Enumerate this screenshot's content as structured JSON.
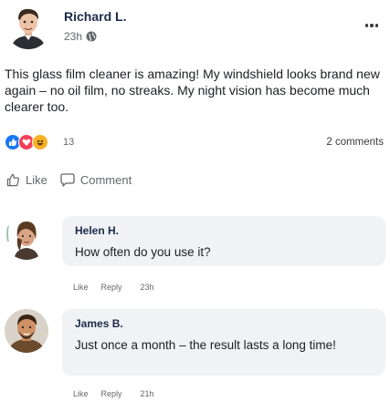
{
  "post": {
    "author": "Richard L.",
    "time": "23h",
    "text": "This glass film cleaner is amazing! My windshield looks brand new again – no oil film, no streaks. My night vision has become much clearer too.",
    "reactions": {
      "icons": [
        "like-reaction",
        "love-reaction",
        "haha-reaction"
      ],
      "colors": {
        "like": "#1877f2",
        "love": "#f33e58",
        "haha": "#f7b125"
      },
      "count": "13"
    },
    "comments_count": "2 comments",
    "actions": {
      "like": "Like",
      "comment": "Comment"
    }
  },
  "comments": [
    {
      "author": "Helen H.",
      "text": "How often do you use it?",
      "actions": {
        "like": "Like",
        "reply": "Reply",
        "time": "23h"
      }
    },
    {
      "author": "James B.",
      "text": "Just once a month – the result lasts a long time!",
      "actions": {
        "like": "Like",
        "reply": "Reply",
        "time": "21h"
      }
    }
  ]
}
